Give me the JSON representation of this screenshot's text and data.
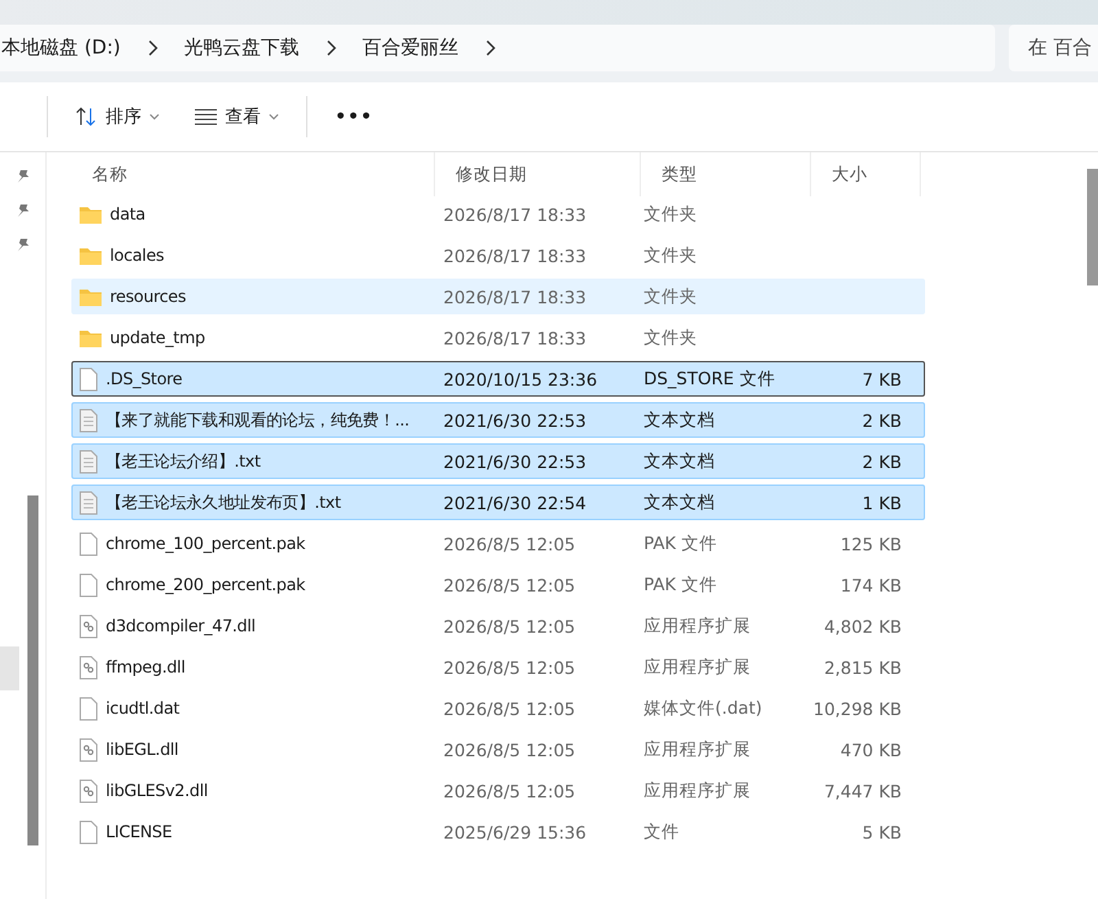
{
  "breadcrumb": [
    {
      "label": "本地磁盘 (D:)"
    },
    {
      "label": "光鸭云盘下载"
    },
    {
      "label": "百合爱丽丝"
    }
  ],
  "search": {
    "placeholder": "在 百合"
  },
  "toolbar": [
    {
      "kind": "sort",
      "label": "排序"
    },
    {
      "kind": "view",
      "label": "查看"
    },
    {
      "kind": "more",
      "label": "•••"
    }
  ],
  "columns": [
    "名称",
    "修改日期",
    "类型",
    "大小"
  ],
  "rows": [
    {
      "kind": "folder",
      "name": "data",
      "date": "2026/8/17 18:33",
      "type": "文件夹",
      "size": "",
      "selected": false,
      "hovered": false,
      "focused": false
    },
    {
      "kind": "folder",
      "name": "locales",
      "date": "2026/8/17 18:33",
      "type": "文件夹",
      "size": "",
      "selected": false,
      "hovered": false,
      "focused": false
    },
    {
      "kind": "folder",
      "name": "resources",
      "date": "2026/8/17 18:33",
      "type": "文件夹",
      "size": "",
      "selected": false,
      "hovered": true,
      "focused": false
    },
    {
      "kind": "folder",
      "name": "update_tmp",
      "date": "2026/8/17 18:33",
      "type": "文件夹",
      "size": "",
      "selected": false,
      "hovered": false,
      "focused": false
    },
    {
      "kind": "file",
      "name": ".DS_Store",
      "date": "2020/10/15 23:36",
      "type": "DS_STORE 文件",
      "size": "7 KB",
      "selected": true,
      "hovered": false,
      "focused": true
    },
    {
      "kind": "text",
      "name": "【来了就能下载和观看的论坛，纯免费！...",
      "date": "2021/6/30 22:53",
      "type": "文本文档",
      "size": "2 KB",
      "selected": true,
      "hovered": false,
      "focused": false
    },
    {
      "kind": "text",
      "name": "【老王论坛介绍】.txt",
      "date": "2021/6/30 22:53",
      "type": "文本文档",
      "size": "2 KB",
      "selected": true,
      "hovered": false,
      "focused": false
    },
    {
      "kind": "text",
      "name": "【老王论坛永久地址发布页】.txt",
      "date": "2021/6/30 22:54",
      "type": "文本文档",
      "size": "1 KB",
      "selected": true,
      "hovered": false,
      "focused": false
    },
    {
      "kind": "file",
      "name": "chrome_100_percent.pak",
      "date": "2026/8/5 12:05",
      "type": "PAK 文件",
      "size": "125 KB",
      "selected": false,
      "hovered": false,
      "focused": false
    },
    {
      "kind": "file",
      "name": "chrome_200_percent.pak",
      "date": "2026/8/5 12:05",
      "type": "PAK 文件",
      "size": "174 KB",
      "selected": false,
      "hovered": false,
      "focused": false
    },
    {
      "kind": "dll",
      "name": "d3dcompiler_47.dll",
      "date": "2026/8/5 12:05",
      "type": "应用程序扩展",
      "size": "4,802 KB",
      "selected": false,
      "hovered": false,
      "focused": false
    },
    {
      "kind": "dll",
      "name": "ffmpeg.dll",
      "date": "2026/8/5 12:05",
      "type": "应用程序扩展",
      "size": "2,815 KB",
      "selected": false,
      "hovered": false,
      "focused": false
    },
    {
      "kind": "file",
      "name": "icudtl.dat",
      "date": "2026/8/5 12:05",
      "type": "媒体文件(.dat)",
      "size": "10,298 KB",
      "selected": false,
      "hovered": false,
      "focused": false
    },
    {
      "kind": "dll",
      "name": "libEGL.dll",
      "date": "2026/8/5 12:05",
      "type": "应用程序扩展",
      "size": "470 KB",
      "selected": false,
      "hovered": false,
      "focused": false
    },
    {
      "kind": "dll",
      "name": "libGLESv2.dll",
      "date": "2026/8/5 12:05",
      "type": "应用程序扩展",
      "size": "7,447 KB",
      "selected": false,
      "hovered": false,
      "focused": false
    },
    {
      "kind": "file",
      "name": "LICENSE",
      "date": "2025/6/29 15:36",
      "type": "文件",
      "size": "5 KB",
      "selected": false,
      "hovered": false,
      "focused": false
    }
  ]
}
